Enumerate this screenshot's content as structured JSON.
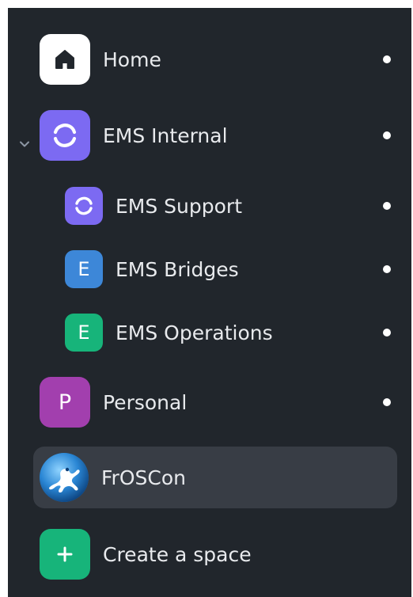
{
  "spaces": {
    "home": {
      "label": "Home",
      "icon": "home-icon",
      "color": "#ffffff"
    },
    "ems_internal": {
      "label": "EMS Internal",
      "icon": "element-logo-icon",
      "color": "#7c6af2",
      "expanded": true,
      "children": [
        {
          "label": "EMS Support",
          "icon": "element-logo-icon",
          "color": "#7c6af2"
        },
        {
          "label": "EMS Bridges",
          "letter": "E",
          "color": "#3d87d8"
        },
        {
          "label": "EMS Operations",
          "letter": "E",
          "color": "#17b47a"
        }
      ]
    },
    "personal": {
      "label": "Personal",
      "letter": "P",
      "color": "#a23fae"
    },
    "froscon": {
      "label": "FrOSCon",
      "icon": "froscon-logo-icon",
      "selected": true
    },
    "create": {
      "label": "Create a space",
      "icon": "plus-icon",
      "color": "#17b47a"
    }
  },
  "colors": {
    "panel_bg": "#21262c",
    "selected_bg": "#383d45",
    "text": "#e8eaed",
    "unread_dot": "#ffffff"
  }
}
